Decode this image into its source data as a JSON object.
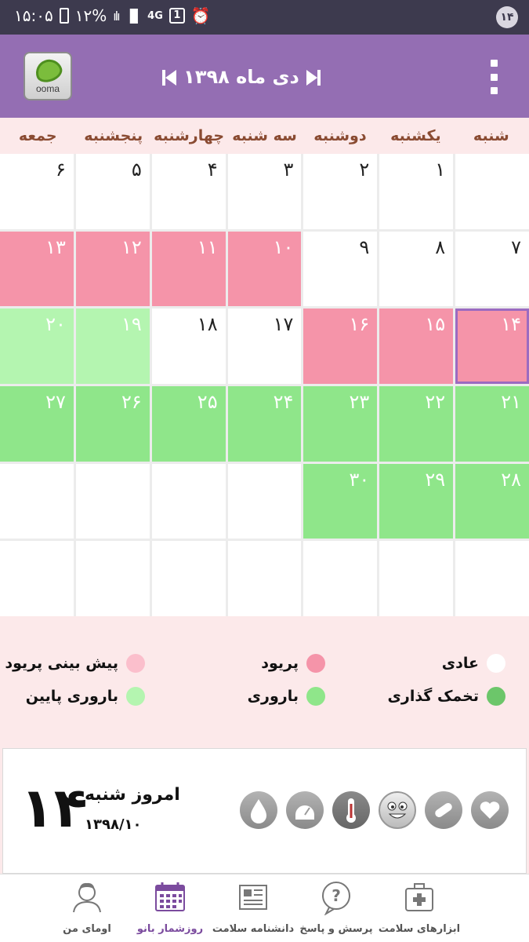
{
  "status_bar": {
    "time": "۱۵:۰۵",
    "battery": "۱۲%",
    "network": "4G",
    "sim": "1",
    "notification_count": "۱۴"
  },
  "header": {
    "logo_text": "ooma",
    "month_title": "دی ماه ۱۳۹۸"
  },
  "weekdays": [
    "شنبه",
    "یکشنبه",
    "دوشنبه",
    "سه شنبه",
    "چهارشنبه",
    "پنجشنبه",
    "جمعه"
  ],
  "calendar": {
    "cells": [
      {
        "day": "",
        "type": "normal"
      },
      {
        "day": "۱",
        "type": "normal"
      },
      {
        "day": "۲",
        "type": "normal"
      },
      {
        "day": "۳",
        "type": "normal"
      },
      {
        "day": "۴",
        "type": "normal"
      },
      {
        "day": "۵",
        "type": "normal"
      },
      {
        "day": "۶",
        "type": "normal"
      },
      {
        "day": "۷",
        "type": "normal"
      },
      {
        "day": "۸",
        "type": "normal"
      },
      {
        "day": "۹",
        "type": "normal"
      },
      {
        "day": "۱۰",
        "type": "period"
      },
      {
        "day": "۱۱",
        "type": "period"
      },
      {
        "day": "۱۲",
        "type": "period"
      },
      {
        "day": "۱۳",
        "type": "period"
      },
      {
        "day": "۱۴",
        "type": "period",
        "today": true
      },
      {
        "day": "۱۵",
        "type": "period"
      },
      {
        "day": "۱۶",
        "type": "period"
      },
      {
        "day": "۱۷",
        "type": "normal"
      },
      {
        "day": "۱۸",
        "type": "normal"
      },
      {
        "day": "۱۹",
        "type": "lowfert"
      },
      {
        "day": "۲۰",
        "type": "lowfert"
      },
      {
        "day": "۲۱",
        "type": "fertile"
      },
      {
        "day": "۲۲",
        "type": "fertile"
      },
      {
        "day": "۲۳",
        "type": "fertile"
      },
      {
        "day": "۲۴",
        "type": "fertile"
      },
      {
        "day": "۲۵",
        "type": "fertile"
      },
      {
        "day": "۲۶",
        "type": "fertile"
      },
      {
        "day": "۲۷",
        "type": "fertile"
      },
      {
        "day": "۲۸",
        "type": "fertile"
      },
      {
        "day": "۲۹",
        "type": "fertile"
      },
      {
        "day": "۳۰",
        "type": "fertile"
      },
      {
        "day": "",
        "type": "normal"
      },
      {
        "day": "",
        "type": "normal"
      },
      {
        "day": "",
        "type": "normal"
      },
      {
        "day": "",
        "type": "normal"
      },
      {
        "day": "",
        "type": "normal"
      },
      {
        "day": "",
        "type": "normal"
      },
      {
        "day": "",
        "type": "normal"
      },
      {
        "day": "",
        "type": "normal"
      },
      {
        "day": "",
        "type": "normal"
      },
      {
        "day": "",
        "type": "normal"
      },
      {
        "day": "",
        "type": "normal"
      }
    ]
  },
  "legend": {
    "normal": "عادی",
    "period": "پریود",
    "predicted_period": "پیش بینی پریود",
    "ovulation": "تخمک گذاری",
    "fertile": "باروری",
    "low_fertility": "باروری پایین",
    "colors": {
      "normal": "#ffffff",
      "period": "#f594a9",
      "predicted_period": "#fbbfcc",
      "ovulation": "#6cc66a",
      "fertile": "#8fe68a",
      "low_fertility": "#b4f5b0"
    }
  },
  "today": {
    "day_number": "۱۴",
    "label": "امروز شنبه",
    "date": "۱۳۹۸/۱۰"
  },
  "tools": [
    "heart-icon",
    "pill-icon",
    "mood-face-icon",
    "thermometer-icon",
    "weight-scale-icon",
    "drop-icon"
  ],
  "bottom_nav": {
    "items": [
      {
        "label": "ابزارهای سلامت",
        "icon": "medical-kit-icon"
      },
      {
        "label": "پرسش و پاسخ",
        "icon": "question-bubble-icon"
      },
      {
        "label": "دانشنامه سلامت",
        "icon": "newspaper-icon"
      },
      {
        "label": "روزشمار بانو",
        "icon": "calendar-icon",
        "active": true
      },
      {
        "label": "اومای من",
        "icon": "profile-icon"
      }
    ]
  }
}
